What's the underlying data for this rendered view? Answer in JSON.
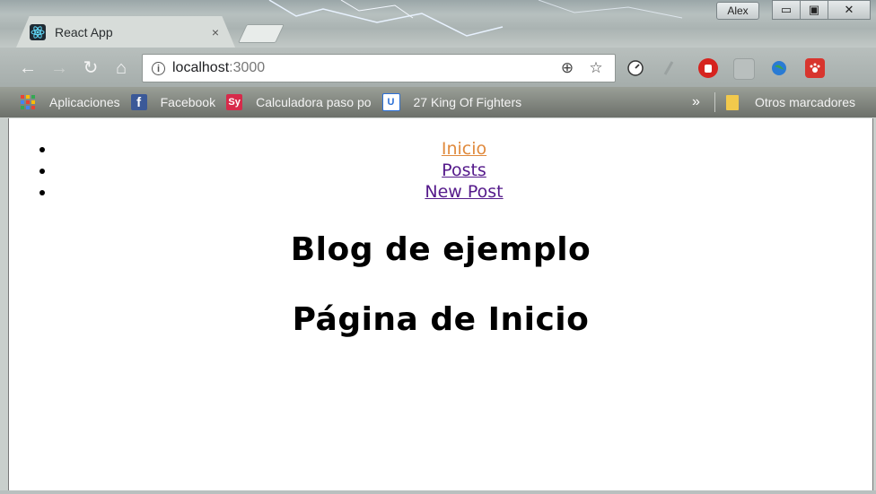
{
  "window": {
    "user": "Alex",
    "minimize": "▭",
    "restore": "▣",
    "close": "✕"
  },
  "tab": {
    "title": "React App",
    "close": "×",
    "favicon": "react-icon"
  },
  "toolbar": {
    "back": "←",
    "forward": "→",
    "reload": "↻",
    "home": "⌂",
    "url_host": "localhost",
    "url_port": ":3000",
    "zoom": "⊕",
    "star": "☆"
  },
  "bookmarks": {
    "items": [
      {
        "label": "Aplicaciones",
        "icon": "apps-grid-icon"
      },
      {
        "label": "Facebook",
        "icon": "facebook-icon"
      },
      {
        "label": "Calculadora paso po",
        "icon": "symbolab-icon",
        "icon_text": "Sy"
      },
      {
        "label": "27 King Of Fighters",
        "icon": "u-icon"
      }
    ],
    "more": "»",
    "other": "Otros marcadores"
  },
  "page": {
    "nav": [
      {
        "label": "Inicio"
      },
      {
        "label": "Posts"
      },
      {
        "label": "New Post"
      }
    ],
    "title": "Blog de ejemplo",
    "subtitle": "Página de Inicio"
  },
  "colors": {
    "link": "#551a8b",
    "link_hover": "#e08a3d",
    "page_bg": "#ffffff"
  }
}
